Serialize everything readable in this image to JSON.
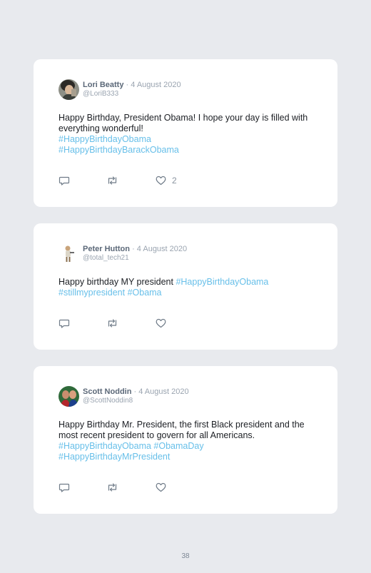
{
  "tweets": [
    {
      "name": "Lori Beatty",
      "separator": "·",
      "date": "4 August 2020",
      "handle": "@LoriB333",
      "text": "Happy Birthday, President Obama! I hope your day is filled with everything wonderful!",
      "tag_line_1": "#HappyBirthdayObama",
      "tag_line_2": "#HappyBirthdayBarackObama",
      "like_count": "2",
      "icons": [
        "reply-icon",
        "retweet-icon",
        "like-icon"
      ]
    },
    {
      "name": "Peter Hutton",
      "separator": "·",
      "date": "4 August 2020",
      "handle": "@total_tech21",
      "text": "Happy birthday MY president ",
      "tag_inline": "#HappyBirthdayObama",
      "tag_line_2": "#stillmypresident #Obama",
      "icons": [
        "reply-icon",
        "retweet-icon",
        "like-icon"
      ]
    },
    {
      "name": "Scott Noddin",
      "separator": "·",
      "date": "4 August 2020",
      "handle": "@ScottNoddin8",
      "text": "Happy Birthday Mr. President, the first Black president and the most recent president to govern for all Americans.",
      "tag_line_1": "#HappyBirthdayObama #ObamaDay",
      "tag_line_2": "#HappyBirthdayMrPresident",
      "icons": [
        "reply-icon",
        "retweet-icon",
        "like-icon"
      ]
    }
  ],
  "page": {
    "number": "38"
  },
  "colors": {
    "background": "#e8eaee",
    "card": "#ffffff",
    "hashtag": "#67bfe9",
    "name": "#5b6878",
    "muted": "#9aa4b0"
  }
}
